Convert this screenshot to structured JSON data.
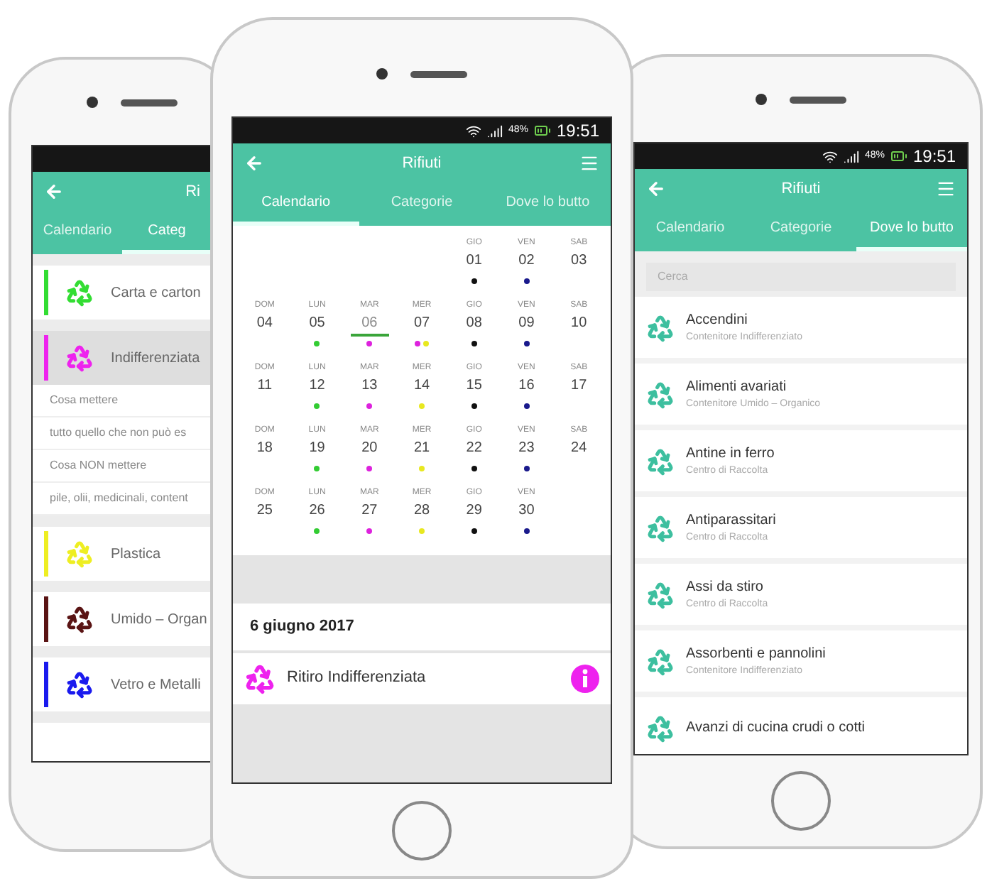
{
  "left_phone": {
    "title": "Ri",
    "tabs": [
      {
        "label": "Calendario",
        "selected": false
      },
      {
        "label": "Categ",
        "selected": true
      }
    ],
    "categories": [
      {
        "name": "Carta e carton",
        "color": "#33dd33",
        "expanded": false
      },
      {
        "name": "Indifferenziata",
        "color": "#ee22ee",
        "expanded": true,
        "details": [
          "Cosa mettere",
          "tutto quello che non può es",
          "Cosa NON mettere",
          "pile, olii, medicinali, content"
        ]
      },
      {
        "name": "Plastica",
        "color": "#eeee22",
        "expanded": false
      },
      {
        "name": "Umido – Organ",
        "color": "#5a1414",
        "expanded": false
      },
      {
        "name": "Vetro e Metalli",
        "color": "#1a1aee",
        "expanded": false
      }
    ]
  },
  "center_phone": {
    "status": {
      "battery": "48%",
      "time": "19:51"
    },
    "title": "Rifiuti",
    "tabs": [
      {
        "label": "Calendario",
        "selected": true
      },
      {
        "label": "Categorie",
        "selected": false
      },
      {
        "label": "Dove lo butto",
        "selected": false
      }
    ],
    "calendar": {
      "weeks": [
        [
          {
            "kind": "blank"
          },
          {
            "kind": "blank"
          },
          {
            "kind": "blank"
          },
          {
            "kind": "blank"
          },
          {
            "kind": "day",
            "weekday": "GIO",
            "day": "01",
            "selected": false,
            "dots": [
              {
                "color": "#111111"
              }
            ]
          },
          {
            "kind": "day",
            "weekday": "VEN",
            "day": "02",
            "selected": false,
            "dots": [
              {
                "color": "#1a1a8c"
              }
            ]
          },
          {
            "kind": "day",
            "weekday": "SAB",
            "day": "03",
            "selected": false
          }
        ],
        [
          {
            "kind": "day",
            "weekday": "DOM",
            "day": "04",
            "selected": false
          },
          {
            "kind": "day",
            "weekday": "LUN",
            "day": "05",
            "selected": false,
            "dots": [
              {
                "color": "#33cc33"
              }
            ]
          },
          {
            "kind": "day",
            "weekday": "MAR",
            "day": "06",
            "selected": true,
            "dots": [
              {
                "color": "#dd22dd"
              }
            ]
          },
          {
            "kind": "day",
            "weekday": "MER",
            "day": "07",
            "selected": false,
            "dots": [
              {
                "color": "#dd22dd"
              },
              {
                "color": "#e8e820"
              }
            ]
          },
          {
            "kind": "day",
            "weekday": "GIO",
            "day": "08",
            "selected": false,
            "dots": [
              {
                "color": "#111111"
              }
            ]
          },
          {
            "kind": "day",
            "weekday": "VEN",
            "day": "09",
            "selected": false,
            "dots": [
              {
                "color": "#1a1a8c"
              }
            ]
          },
          {
            "kind": "day",
            "weekday": "SAB",
            "day": "10",
            "selected": false
          }
        ],
        [
          {
            "kind": "day",
            "weekday": "DOM",
            "day": "11",
            "selected": false
          },
          {
            "kind": "day",
            "weekday": "LUN",
            "day": "12",
            "selected": false,
            "dots": [
              {
                "color": "#33cc33"
              }
            ]
          },
          {
            "kind": "day",
            "weekday": "MAR",
            "day": "13",
            "selected": false,
            "dots": [
              {
                "color": "#dd22dd"
              }
            ]
          },
          {
            "kind": "day",
            "weekday": "MER",
            "day": "14",
            "selected": false,
            "dots": [
              {
                "color": "#e8e820"
              }
            ]
          },
          {
            "kind": "day",
            "weekday": "GIO",
            "day": "15",
            "selected": false,
            "dots": [
              {
                "color": "#111111"
              }
            ]
          },
          {
            "kind": "day",
            "weekday": "VEN",
            "day": "16",
            "selected": false,
            "dots": [
              {
                "color": "#1a1a8c"
              }
            ]
          },
          {
            "kind": "day",
            "weekday": "SAB",
            "day": "17",
            "selected": false
          }
        ],
        [
          {
            "kind": "day",
            "weekday": "DOM",
            "day": "18",
            "selected": false
          },
          {
            "kind": "day",
            "weekday": "LUN",
            "day": "19",
            "selected": false,
            "dots": [
              {
                "color": "#33cc33"
              }
            ]
          },
          {
            "kind": "day",
            "weekday": "MAR",
            "day": "20",
            "selected": false,
            "dots": [
              {
                "color": "#dd22dd"
              }
            ]
          },
          {
            "kind": "day",
            "weekday": "MER",
            "day": "21",
            "selected": false,
            "dots": [
              {
                "color": "#e8e820"
              }
            ]
          },
          {
            "kind": "day",
            "weekday": "GIO",
            "day": "22",
            "selected": false,
            "dots": [
              {
                "color": "#111111"
              }
            ]
          },
          {
            "kind": "day",
            "weekday": "VEN",
            "day": "23",
            "selected": false,
            "dots": [
              {
                "color": "#1a1a8c"
              }
            ]
          },
          {
            "kind": "day",
            "weekday": "SAB",
            "day": "24",
            "selected": false
          }
        ],
        [
          {
            "kind": "day",
            "weekday": "DOM",
            "day": "25",
            "selected": false
          },
          {
            "kind": "day",
            "weekday": "LUN",
            "day": "26",
            "selected": false,
            "dots": [
              {
                "color": "#33cc33"
              }
            ]
          },
          {
            "kind": "day",
            "weekday": "MAR",
            "day": "27",
            "selected": false,
            "dots": [
              {
                "color": "#dd22dd"
              }
            ]
          },
          {
            "kind": "day",
            "weekday": "MER",
            "day": "28",
            "selected": false,
            "dots": [
              {
                "color": "#e8e820"
              }
            ]
          },
          {
            "kind": "day",
            "weekday": "GIO",
            "day": "29",
            "selected": false,
            "dots": [
              {
                "color": "#111111"
              }
            ]
          },
          {
            "kind": "day",
            "weekday": "VEN",
            "day": "30",
            "selected": false,
            "dots": [
              {
                "color": "#1a1a8c"
              }
            ]
          },
          {
            "kind": "blank"
          }
        ]
      ]
    },
    "selected_date": "6 giugno 2017",
    "events": [
      {
        "label": "Ritiro Indifferenziata",
        "color": "#ee22ee"
      }
    ]
  },
  "right_phone": {
    "status": {
      "battery": "48%",
      "time": "19:51"
    },
    "title": "Rifiuti",
    "tabs": [
      {
        "label": "Calendario",
        "selected": false
      },
      {
        "label": "Categorie",
        "selected": false
      },
      {
        "label": "Dove lo butto",
        "selected": true
      }
    ],
    "search": {
      "placeholder": "Cerca"
    },
    "items": [
      {
        "name": "Accendini",
        "place": "Contenitore Indifferenziato"
      },
      {
        "name": "Alimenti avariati",
        "place": "Contenitore Umido – Organico"
      },
      {
        "name": "Antine in ferro",
        "place": "Centro di Raccolta"
      },
      {
        "name": "Antiparassitari",
        "place": "Centro di Raccolta"
      },
      {
        "name": "Assi da stiro",
        "place": "Centro di Raccolta"
      },
      {
        "name": "Assorbenti e pannolini",
        "place": "Contenitore Indifferenziato"
      },
      {
        "name": "Avanzi di cucina crudi o cotti"
      }
    ]
  }
}
